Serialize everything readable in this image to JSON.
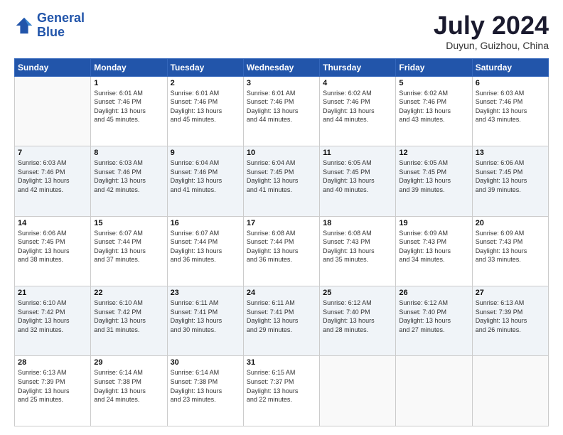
{
  "header": {
    "logo_line1": "General",
    "logo_line2": "Blue",
    "month_year": "July 2024",
    "location": "Duyun, Guizhou, China"
  },
  "days_of_week": [
    "Sunday",
    "Monday",
    "Tuesday",
    "Wednesday",
    "Thursday",
    "Friday",
    "Saturday"
  ],
  "weeks": [
    [
      {
        "day": "",
        "info": ""
      },
      {
        "day": "1",
        "info": "Sunrise: 6:01 AM\nSunset: 7:46 PM\nDaylight: 13 hours\nand 45 minutes."
      },
      {
        "day": "2",
        "info": "Sunrise: 6:01 AM\nSunset: 7:46 PM\nDaylight: 13 hours\nand 45 minutes."
      },
      {
        "day": "3",
        "info": "Sunrise: 6:01 AM\nSunset: 7:46 PM\nDaylight: 13 hours\nand 44 minutes."
      },
      {
        "day": "4",
        "info": "Sunrise: 6:02 AM\nSunset: 7:46 PM\nDaylight: 13 hours\nand 44 minutes."
      },
      {
        "day": "5",
        "info": "Sunrise: 6:02 AM\nSunset: 7:46 PM\nDaylight: 13 hours\nand 43 minutes."
      },
      {
        "day": "6",
        "info": "Sunrise: 6:03 AM\nSunset: 7:46 PM\nDaylight: 13 hours\nand 43 minutes."
      }
    ],
    [
      {
        "day": "7",
        "info": "Sunrise: 6:03 AM\nSunset: 7:46 PM\nDaylight: 13 hours\nand 42 minutes."
      },
      {
        "day": "8",
        "info": "Sunrise: 6:03 AM\nSunset: 7:46 PM\nDaylight: 13 hours\nand 42 minutes."
      },
      {
        "day": "9",
        "info": "Sunrise: 6:04 AM\nSunset: 7:46 PM\nDaylight: 13 hours\nand 41 minutes."
      },
      {
        "day": "10",
        "info": "Sunrise: 6:04 AM\nSunset: 7:45 PM\nDaylight: 13 hours\nand 41 minutes."
      },
      {
        "day": "11",
        "info": "Sunrise: 6:05 AM\nSunset: 7:45 PM\nDaylight: 13 hours\nand 40 minutes."
      },
      {
        "day": "12",
        "info": "Sunrise: 6:05 AM\nSunset: 7:45 PM\nDaylight: 13 hours\nand 39 minutes."
      },
      {
        "day": "13",
        "info": "Sunrise: 6:06 AM\nSunset: 7:45 PM\nDaylight: 13 hours\nand 39 minutes."
      }
    ],
    [
      {
        "day": "14",
        "info": "Sunrise: 6:06 AM\nSunset: 7:45 PM\nDaylight: 13 hours\nand 38 minutes."
      },
      {
        "day": "15",
        "info": "Sunrise: 6:07 AM\nSunset: 7:44 PM\nDaylight: 13 hours\nand 37 minutes."
      },
      {
        "day": "16",
        "info": "Sunrise: 6:07 AM\nSunset: 7:44 PM\nDaylight: 13 hours\nand 36 minutes."
      },
      {
        "day": "17",
        "info": "Sunrise: 6:08 AM\nSunset: 7:44 PM\nDaylight: 13 hours\nand 36 minutes."
      },
      {
        "day": "18",
        "info": "Sunrise: 6:08 AM\nSunset: 7:43 PM\nDaylight: 13 hours\nand 35 minutes."
      },
      {
        "day": "19",
        "info": "Sunrise: 6:09 AM\nSunset: 7:43 PM\nDaylight: 13 hours\nand 34 minutes."
      },
      {
        "day": "20",
        "info": "Sunrise: 6:09 AM\nSunset: 7:43 PM\nDaylight: 13 hours\nand 33 minutes."
      }
    ],
    [
      {
        "day": "21",
        "info": "Sunrise: 6:10 AM\nSunset: 7:42 PM\nDaylight: 13 hours\nand 32 minutes."
      },
      {
        "day": "22",
        "info": "Sunrise: 6:10 AM\nSunset: 7:42 PM\nDaylight: 13 hours\nand 31 minutes."
      },
      {
        "day": "23",
        "info": "Sunrise: 6:11 AM\nSunset: 7:41 PM\nDaylight: 13 hours\nand 30 minutes."
      },
      {
        "day": "24",
        "info": "Sunrise: 6:11 AM\nSunset: 7:41 PM\nDaylight: 13 hours\nand 29 minutes."
      },
      {
        "day": "25",
        "info": "Sunrise: 6:12 AM\nSunset: 7:40 PM\nDaylight: 13 hours\nand 28 minutes."
      },
      {
        "day": "26",
        "info": "Sunrise: 6:12 AM\nSunset: 7:40 PM\nDaylight: 13 hours\nand 27 minutes."
      },
      {
        "day": "27",
        "info": "Sunrise: 6:13 AM\nSunset: 7:39 PM\nDaylight: 13 hours\nand 26 minutes."
      }
    ],
    [
      {
        "day": "28",
        "info": "Sunrise: 6:13 AM\nSunset: 7:39 PM\nDaylight: 13 hours\nand 25 minutes."
      },
      {
        "day": "29",
        "info": "Sunrise: 6:14 AM\nSunset: 7:38 PM\nDaylight: 13 hours\nand 24 minutes."
      },
      {
        "day": "30",
        "info": "Sunrise: 6:14 AM\nSunset: 7:38 PM\nDaylight: 13 hours\nand 23 minutes."
      },
      {
        "day": "31",
        "info": "Sunrise: 6:15 AM\nSunset: 7:37 PM\nDaylight: 13 hours\nand 22 minutes."
      },
      {
        "day": "",
        "info": ""
      },
      {
        "day": "",
        "info": ""
      },
      {
        "day": "",
        "info": ""
      }
    ]
  ]
}
